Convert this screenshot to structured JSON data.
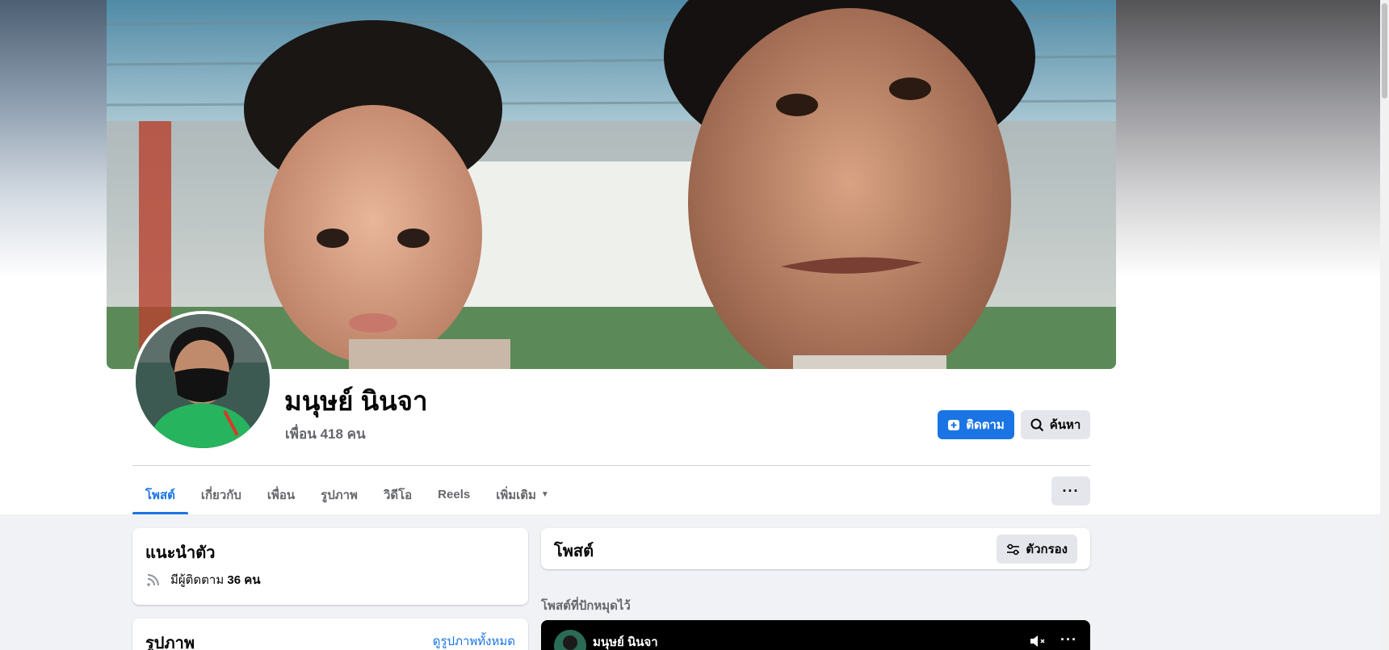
{
  "profile": {
    "name": "มนุษย์ นินจา",
    "friends": "เพื่อน 418 คน"
  },
  "actions": {
    "follow_label": "ติดตาม",
    "search_label": "ค้นหา",
    "more_label": "···"
  },
  "tabs": [
    {
      "label": "โพสต์",
      "active": true
    },
    {
      "label": "เกี่ยวกับ"
    },
    {
      "label": "เพื่อน"
    },
    {
      "label": "รูปภาพ"
    },
    {
      "label": "วิดีโอ"
    },
    {
      "label": "Reels"
    },
    {
      "label": "เพิ่มเติม"
    }
  ],
  "intro": {
    "title": "แนะนำตัว",
    "followers_prefix": "มีผู้ติดตาม ",
    "followers_count": "36 คน"
  },
  "photos": {
    "title": "รูปภาพ",
    "see_all": "ดูรูปภาพทั้งหมด"
  },
  "posts": {
    "title": "โพสต์",
    "filter_label": "ตัวกรอง",
    "pinned_label": "โพสต์ที่ปักหมุดไว้",
    "pinned_author": "มนุษย์ นินจา",
    "more_label": "···"
  },
  "colors": {
    "accent": "#1b74e4",
    "page_bg": "#f0f2f5",
    "secondary_button": "#e4e6eb"
  },
  "icons": {
    "follow": "add-friend-icon",
    "search": "search-icon",
    "followers": "rss-icon",
    "filter": "sliders-icon",
    "mute": "speaker-muted-icon"
  }
}
